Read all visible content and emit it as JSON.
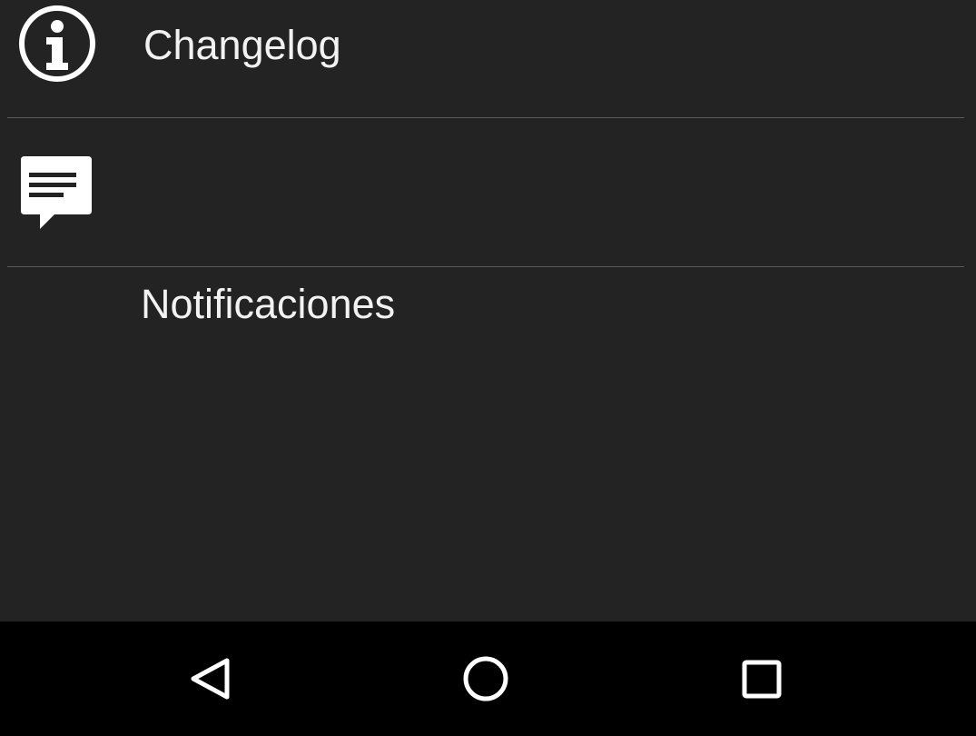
{
  "menu": {
    "items": [
      {
        "label": "Changelog",
        "icon": "info-circle-icon"
      },
      {
        "label": "Notificaciones",
        "icon": "message-bubble-icon"
      }
    ]
  },
  "navbar": {
    "buttons": [
      {
        "icon": "back-triangle-icon"
      },
      {
        "icon": "home-circle-icon"
      },
      {
        "icon": "recents-square-icon"
      }
    ]
  },
  "colors": {
    "background": "#232323",
    "text": "#f2f2f2",
    "divider": "#5a5a5a",
    "navbar": "#000000"
  }
}
